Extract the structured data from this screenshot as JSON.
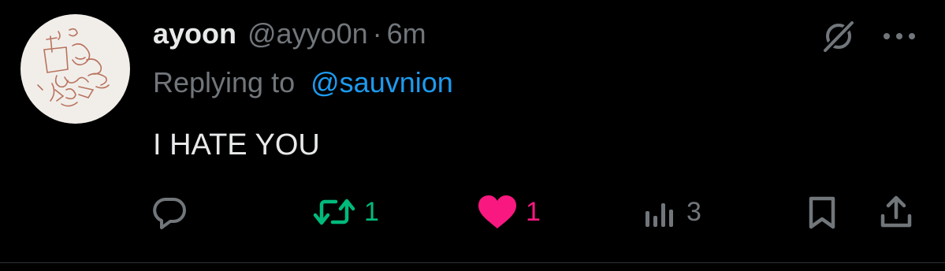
{
  "tweet": {
    "author_name": "ayoon",
    "author_handle": "@ayyo0n",
    "separator": "·",
    "time": "6m",
    "reply_prefix": "Replying to",
    "reply_to": "@sauvnion",
    "text": "I HATE YOU",
    "avatar_icon": "sketch-drawing-avatar"
  },
  "actions": {
    "reply_icon": "speech-bubble-icon",
    "retweet_icon": "retweet-icon",
    "retweet_count": "1",
    "like_icon": "heart-icon",
    "like_count": "1",
    "views_icon": "bar-chart-icon",
    "views_count": "3",
    "bookmark_icon": "bookmark-icon",
    "share_icon": "share-icon"
  },
  "colors": {
    "background": "#000000",
    "primary_text": "#e7e9ea",
    "secondary_text": "#71767b",
    "link": "#1d9bf0",
    "retweet_active": "#00ba7c",
    "like_active": "#f91880"
  }
}
